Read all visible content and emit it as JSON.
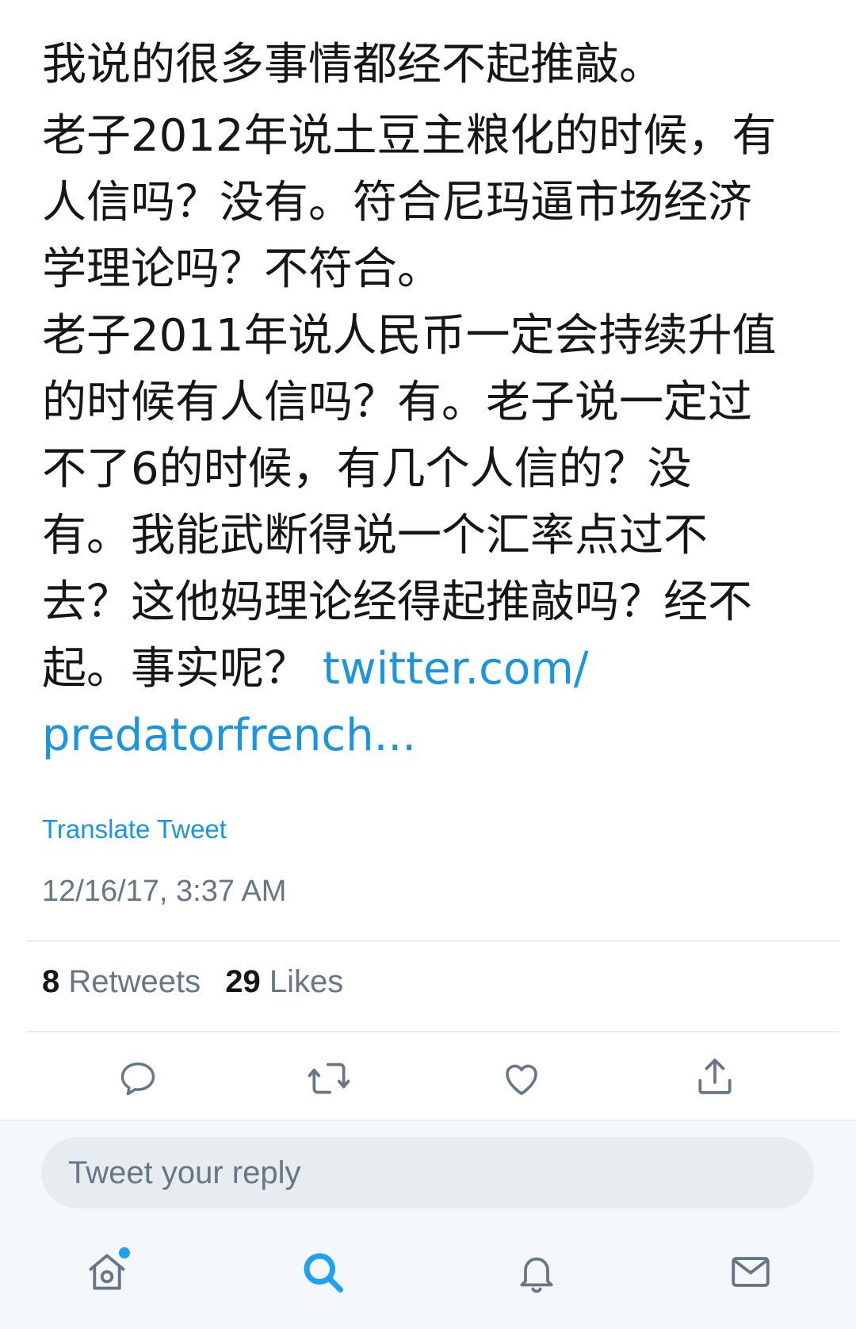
{
  "tweet": {
    "paragraph1": "我说的很多事情都经不起推敲。",
    "paragraph2_lines": [
      "老子2012年说土豆主粮化的时候，有",
      "人信吗？没有。符合尼玛逼市场经济",
      "学理论吗？不符合。",
      "老子2011年说人民币一定会持续升值",
      "的时候有人信吗？有。老子说一定过",
      "不了6的时候，有几个人信的？没",
      "有。我能武断得说一个汇率点过不",
      "去？这他妈理论经得起推敲吗？经不",
      "起。事实呢？"
    ],
    "link_line1": "twitter.com/",
    "link_line2": "predatorfrench...",
    "translate_label": "Translate Tweet",
    "timestamp": "12/16/17, 3:37 AM"
  },
  "stats": {
    "retweets_count": "8",
    "retweets_label": "Retweets",
    "likes_count": "29",
    "likes_label": "Likes"
  },
  "actions": {
    "icons": [
      "reply-icon",
      "retweet-icon",
      "like-icon",
      "share-icon"
    ]
  },
  "reply": {
    "placeholder": "Tweet your reply"
  },
  "tabbar": {
    "icons": [
      "home-icon",
      "search-icon",
      "notifications-icon",
      "messages-icon"
    ],
    "active": "search-icon",
    "home_has_notification": true
  },
  "colors": {
    "link": "#1b95e0",
    "accent": "#1da1f2",
    "text": "#14171a",
    "secondary": "#657786",
    "icon": "#657786",
    "divider": "#e6ecf0"
  }
}
